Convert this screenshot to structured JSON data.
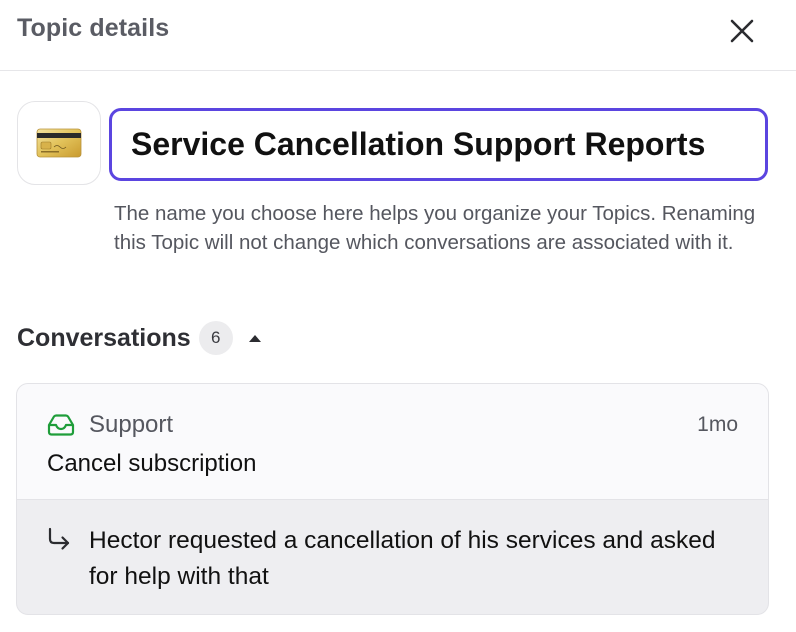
{
  "header": {
    "title": "Topic details"
  },
  "topic": {
    "name": "Service Cancellation Support Reports",
    "icon": "credit-card-icon",
    "helper_text": "The name you choose here helps you organize your Topics. Renaming this Topic will not change which conversations are associated with it."
  },
  "conversations": {
    "title": "Conversations",
    "count": "6",
    "items": [
      {
        "inbox": "Support",
        "inbox_icon": "inbox-icon",
        "time": "1mo",
        "subject": "Cancel subscription",
        "summary": "Hector requested a cancellation of his services and asked for help with that"
      }
    ]
  },
  "colors": {
    "accent": "#5b45e0",
    "inbox_green": "#1f9d3a"
  }
}
